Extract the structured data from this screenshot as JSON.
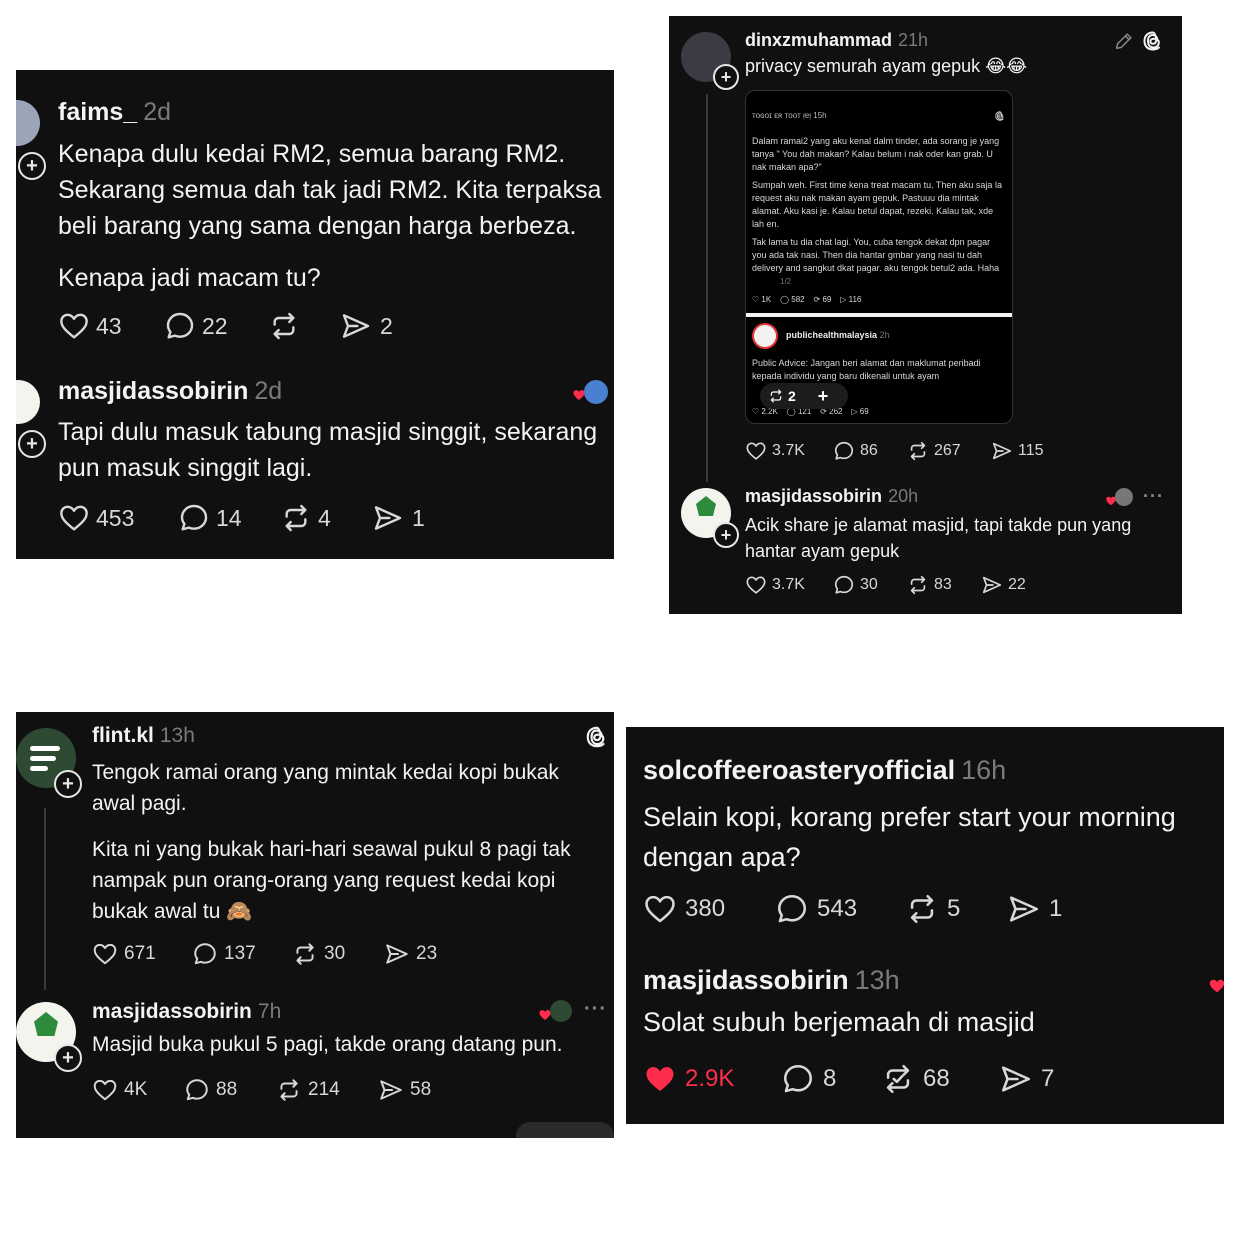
{
  "p1": {
    "post": {
      "user": "faims_",
      "time": "2d",
      "lines": [
        "Kenapa dulu kedai RM2, semua barang RM2.",
        "Sekarang semua dah tak jadi RM2. Kita terpaksa",
        "beli barang yang sama dengan harga berbeza."
      ],
      "line2": "Kenapa jadi macam tu?",
      "likes": "43",
      "replies": "22",
      "reposts": "",
      "shares": "2"
    },
    "reply": {
      "user": "masjidassobirin",
      "time": "2d",
      "lines": [
        "Tapi dulu masuk tabung masjid singgit, sekarang",
        "pun masuk singgit lagi."
      ],
      "likes": "453",
      "replies": "14",
      "reposts": "4",
      "shares": "1"
    }
  },
  "p2": {
    "post": {
      "user": "dinxzmuhammad",
      "time": "21h",
      "text": "privacy semurah ayam gepuk 😂😂",
      "likes": "3.7K",
      "replies": "86",
      "reposts": "267",
      "shares": "115"
    },
    "embed": {
      "head": "ᴛᴏɢᴏɪ ᴇʀ ᴛᴏᴏᴛ ᴉɐᴉ 15h",
      "para1": "Dalam ramai2 yang aku kenal dalm tinder, ada sorang je yang tanya \" You dah makan? Kalau belum i nak oder kan grab. U nak makan apa?\"",
      "para2": "Sumpah weh. First time kena treat macam tu. Then aku saja la request aku nak makan ayam gepuk. Pastuuu dia mintak alamat. Aku kasi je. Kalau betul dapat, rezeki. Kalau tak, xde lah en.",
      "para3": "Tak lama tu dia chat lagi. You, cuba tengok dekat dpn pagar you ada tak nasi. Then dia hantar gmbar yang nasi tu dah delivery and sangkut dkat pagar. aku tengok betul2 ada. Haha",
      "page": "1/2",
      "stats1": [
        "1K",
        "582",
        "69",
        "116"
      ],
      "user2": "publichealthmalaysia",
      "time2": "2h",
      "para4": "Public Advice: Jangan beri alamat dan maklumat peribadi kepada individu yang baru dikenali untuk ayam",
      "stats2": [
        "2.2K",
        "121",
        "262",
        "69"
      ],
      "pill": "2"
    },
    "reply": {
      "user": "masjidassobirin",
      "time": "20h",
      "lines": [
        "Acik share je alamat masjid, tapi takde pun yang",
        "hantar ayam gepuk"
      ],
      "likes": "3.7K",
      "replies": "30",
      "reposts": "83",
      "shares": "22"
    }
  },
  "p3": {
    "post": {
      "user": "flint.kl",
      "time": "13h",
      "lines1": [
        "Tengok ramai orang yang mintak kedai kopi bukak",
        "awal pagi."
      ],
      "lines2": [
        "Kita ni yang bukak hari-hari seawal pukul 8 pagi tak",
        "nampak pun orang-orang yang request kedai kopi",
        "bukak awal tu 🙈"
      ],
      "likes": "671",
      "replies": "137",
      "reposts": "30",
      "shares": "23"
    },
    "reply": {
      "user": "masjidassobirin",
      "time": "7h",
      "text": "Masjid buka pukul 5 pagi, takde orang datang pun.",
      "likes": "4K",
      "replies": "88",
      "reposts": "214",
      "shares": "58"
    }
  },
  "p4": {
    "post": {
      "user": "solcoffeeroasteryofficial",
      "time": "16h",
      "lines": [
        "Selain kopi, korang prefer start your morning",
        "dengan apa?"
      ],
      "likes": "380",
      "replies": "543",
      "reposts": "5",
      "shares": "1"
    },
    "reply": {
      "user": "masjidassobirin",
      "time": "13h",
      "text": "Solat subuh berjemaah di masjid",
      "likes": "2.9K",
      "replies": "8",
      "reposts": "68",
      "shares": "7"
    }
  },
  "colors": {
    "bg": "#101010",
    "text": "#f3f3f3",
    "muted": "#7a7a7a",
    "like_red": "#ff2d4b"
  }
}
